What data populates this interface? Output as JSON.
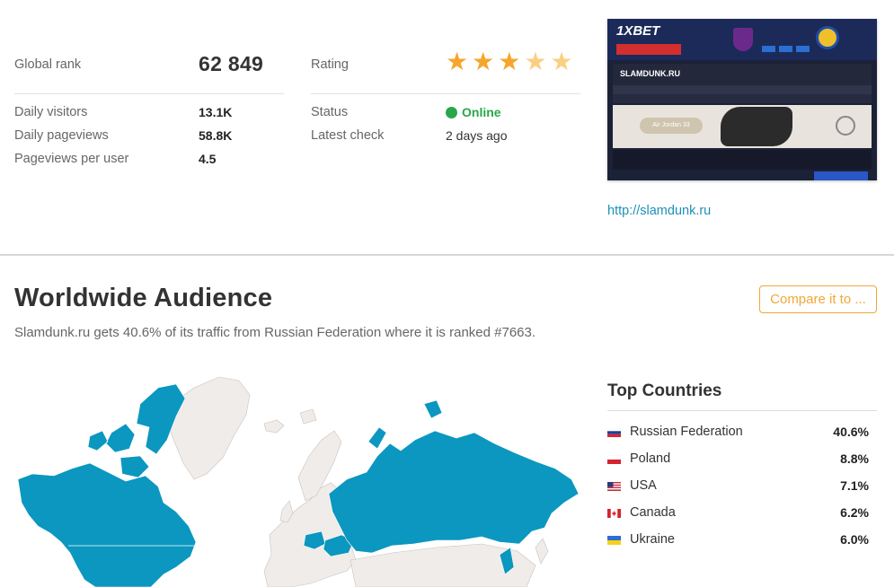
{
  "metrics": {
    "global_rank_label": "Global rank",
    "global_rank_value": "62 849",
    "rating_label": "Rating",
    "rating_stars": 3,
    "rating_max": 5,
    "rows_left": [
      {
        "label": "Daily visitors",
        "value": "13.1K"
      },
      {
        "label": "Daily pageviews",
        "value": "58.8K"
      },
      {
        "label": "Pageviews per user",
        "value": "4.5"
      }
    ],
    "status_label": "Status",
    "status_value": "Online",
    "latest_check_label": "Latest check",
    "latest_check_value": "2 days ago"
  },
  "preview": {
    "brand": "1XBET",
    "site_logo": "SLAMDUNK.RU",
    "hero_text": "Air Jordan 33",
    "link": "http://slamdunk.ru"
  },
  "audience": {
    "title": "Worldwide Audience",
    "compare_label": "Compare it to ...",
    "description": "Slamdunk.ru gets 40.6% of its traffic from Russian Federation where it is ranked #7663."
  },
  "top_countries": {
    "title": "Top Countries",
    "items": [
      {
        "name": "Russian Federation",
        "pct": "40.6%",
        "flag": "ru"
      },
      {
        "name": "Poland",
        "pct": "8.8%",
        "flag": "pl"
      },
      {
        "name": "USA",
        "pct": "7.1%",
        "flag": "us"
      },
      {
        "name": "Canada",
        "pct": "6.2%",
        "flag": "ca"
      },
      {
        "name": "Ukraine",
        "pct": "6.0%",
        "flag": "ua"
      }
    ]
  },
  "colors": {
    "accent_map": "#0b97bf",
    "land": "#f0ecea",
    "star": "#f7a52b",
    "online": "#27a74a",
    "compare": "#f1a73a",
    "link": "#1e8fb8"
  }
}
